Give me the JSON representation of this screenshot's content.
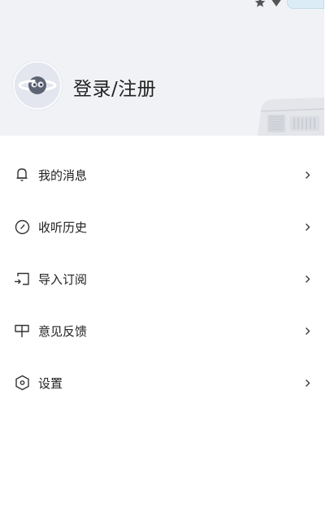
{
  "header": {
    "login_label": "登录/注册"
  },
  "menu": {
    "items": [
      {
        "label": "我的消息",
        "icon": "bell-icon"
      },
      {
        "label": "收听历史",
        "icon": "clock-icon"
      },
      {
        "label": "导入订阅",
        "icon": "import-icon"
      },
      {
        "label": "意见反馈",
        "icon": "feedback-icon"
      },
      {
        "label": "设置",
        "icon": "settings-icon"
      }
    ]
  },
  "colors": {
    "header_background": "#f1f2f6",
    "text": "#222222",
    "icon_stroke": "#333333"
  }
}
